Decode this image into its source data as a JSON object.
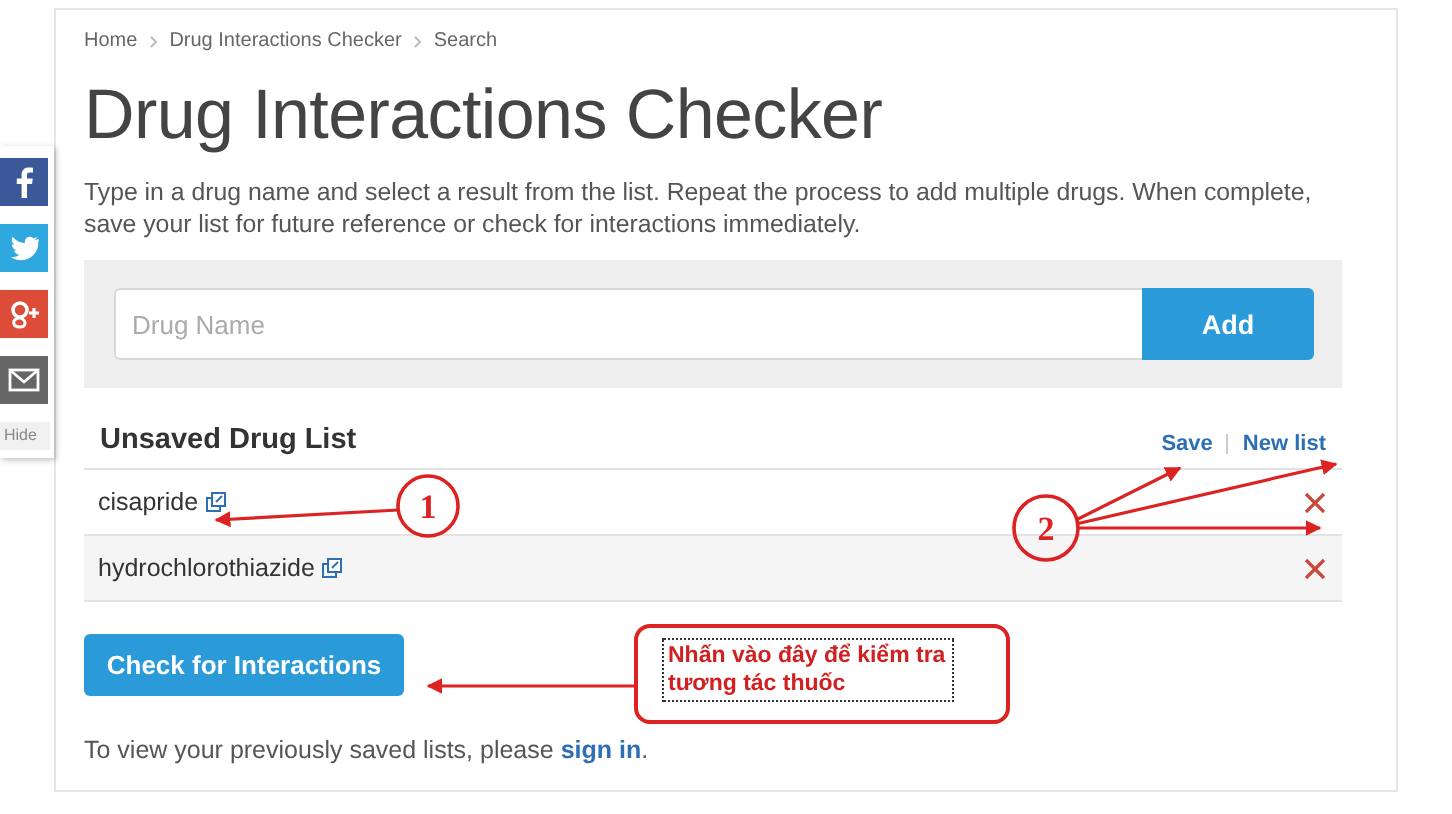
{
  "breadcrumb": [
    {
      "label": "Home"
    },
    {
      "label": "Drug Interactions Checker"
    },
    {
      "label": "Search"
    }
  ],
  "title": "Drug Interactions Checker",
  "intro": "Type in a drug name and select a result from the list. Repeat the process to add multiple drugs. When complete, save your list for future reference or check for interactions immediately.",
  "search": {
    "placeholder": "Drug Name",
    "button": "Add"
  },
  "drug_list": {
    "heading": "Unsaved Drug List",
    "actions": [
      "Save",
      "New list"
    ],
    "drugs": [
      {
        "name": "cisapride"
      },
      {
        "name": "hydrochlorothiazide"
      }
    ]
  },
  "check_button": "Check for Interactions",
  "footer": {
    "text": "To view your previously saved lists, please ",
    "link": "sign in",
    "end": "."
  },
  "share_bar": {
    "hide": "Hide"
  },
  "annotations": [
    {
      "kind": "marker",
      "label": "1"
    },
    {
      "kind": "marker",
      "label": "2"
    },
    {
      "kind": "callout",
      "text": "Nhấn vào đây để kiểm tra tương tác thuốc"
    }
  ]
}
